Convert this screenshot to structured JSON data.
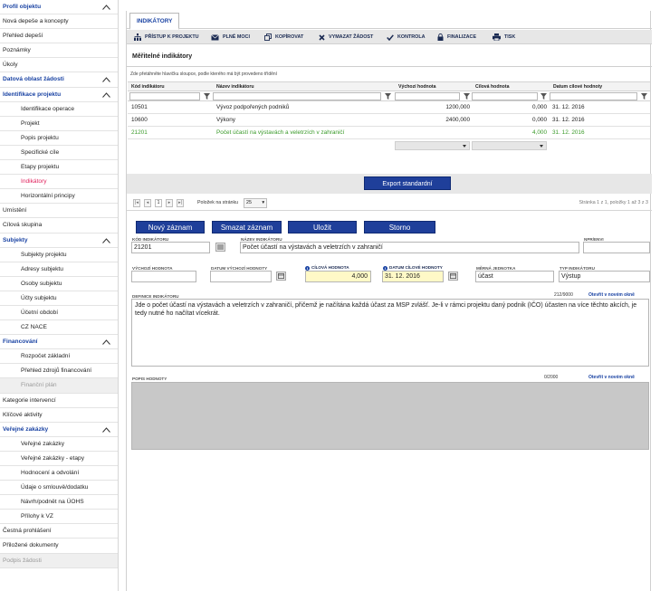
{
  "sidebar": {
    "items": [
      {
        "label": "Profil objektu",
        "type": "head",
        "chevron": true
      },
      {
        "label": "Nová depeše a koncepty",
        "type": "item"
      },
      {
        "label": "Přehled depeší",
        "type": "item"
      },
      {
        "label": "Poznámky",
        "type": "item"
      },
      {
        "label": "Úkoly",
        "type": "item"
      },
      {
        "label": "Datová oblast žádosti",
        "type": "head",
        "chevron": true
      },
      {
        "label": "Identifikace projektu",
        "type": "head",
        "chevron": true
      },
      {
        "label": "Identifikace operace",
        "type": "sub"
      },
      {
        "label": "Projekt",
        "type": "sub"
      },
      {
        "label": "Popis projektu",
        "type": "sub"
      },
      {
        "label": "Specifické cíle",
        "type": "sub"
      },
      {
        "label": "Etapy projektu",
        "type": "sub"
      },
      {
        "label": "Indikátory",
        "type": "sub-active"
      },
      {
        "label": "Horizontální principy",
        "type": "sub"
      },
      {
        "label": "Umístění",
        "type": "item"
      },
      {
        "label": "Cílová skupina",
        "type": "item"
      },
      {
        "label": "Subjekty",
        "type": "head",
        "chevron": true
      },
      {
        "label": "Subjekty projektu",
        "type": "sub"
      },
      {
        "label": "Adresy subjektu",
        "type": "sub"
      },
      {
        "label": "Osoby subjektu",
        "type": "sub"
      },
      {
        "label": "Účty subjektu",
        "type": "sub"
      },
      {
        "label": "Účetní období",
        "type": "sub"
      },
      {
        "label": "CZ NACE",
        "type": "sub"
      },
      {
        "label": "Financování",
        "type": "head",
        "chevron": true
      },
      {
        "label": "Rozpočet základní",
        "type": "sub"
      },
      {
        "label": "Přehled zdrojů financování",
        "type": "sub"
      },
      {
        "label": "Finanční plán",
        "type": "sub-disabled"
      },
      {
        "label": "Kategorie intervencí",
        "type": "item"
      },
      {
        "label": "Klíčové aktivity",
        "type": "item"
      },
      {
        "label": "Veřejné zakázky",
        "type": "head",
        "chevron": true
      },
      {
        "label": "Veřejné zakázky",
        "type": "sub"
      },
      {
        "label": "Veřejné zakázky - etapy",
        "type": "sub"
      },
      {
        "label": "Hodnocení a odvolání",
        "type": "sub"
      },
      {
        "label": "Údaje o smlouvě/dodatku",
        "type": "sub"
      },
      {
        "label": "Návrh/podnět na ÚOHS",
        "type": "sub"
      },
      {
        "label": "Přílohy k VZ",
        "type": "sub"
      },
      {
        "label": "Čestná prohlášení",
        "type": "item"
      },
      {
        "label": "Přiložené dokumenty",
        "type": "item"
      },
      {
        "label": "Podpis žádosti",
        "type": "disabled"
      }
    ]
  },
  "tab": {
    "label": "INDIKÁTORY"
  },
  "toolbar": {
    "access": "PŘÍSTUP K PROJEKTU",
    "powers": "PLNÉ MOCI",
    "copy": "KOPÍROVAT",
    "delete": "VYMAZAT ŽÁDOST",
    "check": "KONTROLA",
    "finalize": "FINALIZACE",
    "print": "TISK"
  },
  "section": {
    "title": "Měřitelné indikátory",
    "hint": "Zde přetáhněte hlavičku sloupce, podle kterého má být provedeno třídění"
  },
  "grid": {
    "headers": [
      "Kód indikátoru",
      "Název indikátoru",
      "Výchozí hodnota",
      "Cílová hodnota",
      "Datum cílové hodnoty"
    ],
    "rows": [
      {
        "code": "10501",
        "name": "Vývoz podpořených podniků",
        "start": "1200,000",
        "target": "0,000",
        "date": "31. 12. 2016"
      },
      {
        "code": "10600",
        "name": "Výkony",
        "start": "2400,000",
        "target": "0,000",
        "date": "31. 12. 2016"
      },
      {
        "code": "21201",
        "name": "Počet účastí na výstavách a veletrzích v zahraničí",
        "start": "",
        "target": "4,000",
        "date": "31. 12. 2016"
      }
    ]
  },
  "export": {
    "label": "Export standardní"
  },
  "pager": {
    "current_page": "1",
    "per_page_label": "Položek na stránku",
    "per_page": "25",
    "info": "Stránka 1 z 1, položky 1 až 3 z 3"
  },
  "actions": {
    "new": "Nový záznam",
    "delete": "Smazat záznam",
    "save": "Uložit",
    "cancel": "Storno"
  },
  "form": {
    "code_label": "KÓD INDIKÁTORU",
    "code_value": "21201",
    "name_label": "NÁZEV INDIKÁTORU",
    "name_value": "Počet účastí na výstavách a veletrzích v zahraničí",
    "npr_label": "NPR/ENVI",
    "npr_value": "",
    "start_label": "VÝCHOZÍ HODNOTA",
    "start_value": "",
    "start_date_label": "DATUM VÝCHOZÍ HODNOTY",
    "start_date_value": "",
    "target_label": "CÍLOVÁ HODNOTA",
    "target_value": "4,000",
    "target_date_label": "DATUM CÍLOVÉ HODNOTY",
    "target_date_value": "31. 12. 2016",
    "unit_label": "MĚRNÁ JEDNOTKA",
    "unit_value": "účast",
    "type_label": "TYP INDIKÁTORU",
    "type_value": "Výstup",
    "definition_label": "DEFINICE INDIKÁTORU",
    "definition_counter": "212/9000",
    "definition_link": "Otevřít v novém okně",
    "definition_text": "Jde o počet účastí na výstavách a veletrzích v zahraničí, přičemž je načítána každá účast za MSP zvlášť. Je-li v rámci projektu daný podnik (IČO) účasten na více těchto akcích, je tedy nutné ho načítat vícekrát.",
    "desc_label": "POPIS HODNOTY",
    "desc_counter": "0/2000",
    "desc_link": "Otevřít v novém okně",
    "info_mark": "i"
  },
  "colors": {
    "accent": "#1a43a3",
    "button": "#1f3f9a",
    "active": "#e0245e",
    "green": "#3a9a2a",
    "required_bg": "#fff9c7"
  }
}
